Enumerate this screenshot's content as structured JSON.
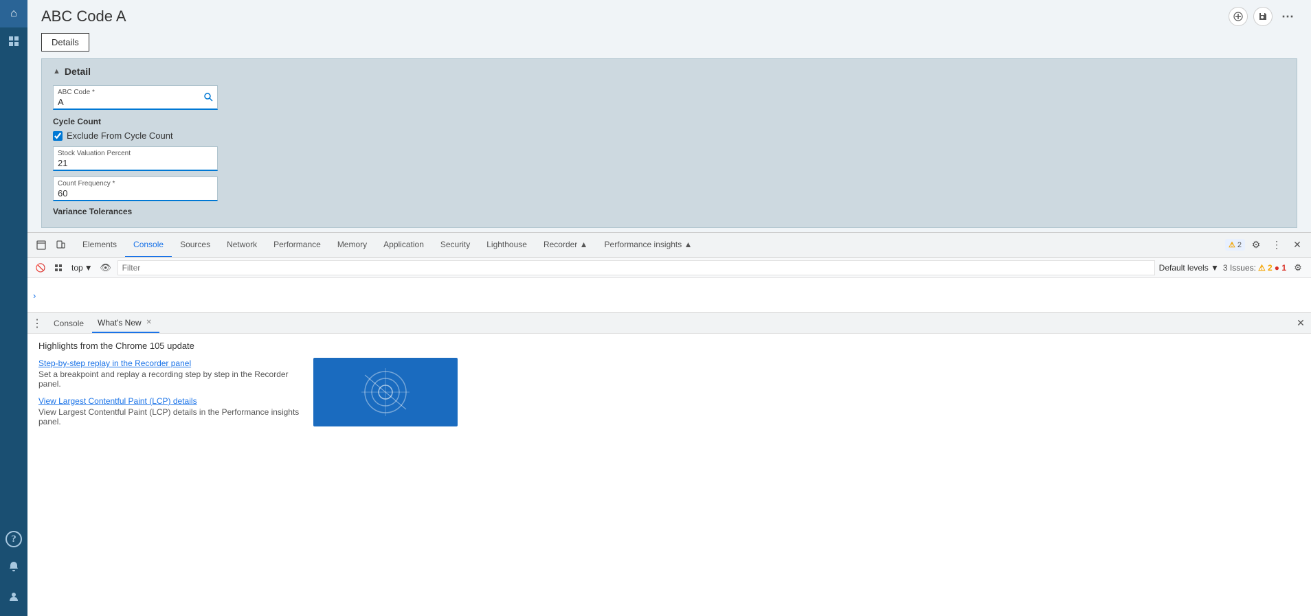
{
  "sidebar": {
    "icons": [
      {
        "name": "home-icon",
        "symbol": "⌂",
        "active": true
      },
      {
        "name": "grid-icon",
        "symbol": "⊞",
        "active": false
      },
      {
        "name": "help-icon",
        "symbol": "?",
        "active": false
      },
      {
        "name": "bell-icon",
        "symbol": "🔔",
        "active": false
      },
      {
        "name": "user-icon",
        "symbol": "👤",
        "active": false
      }
    ]
  },
  "page": {
    "title": "ABC Code A",
    "tabs": [
      {
        "label": "Details",
        "active": true
      }
    ]
  },
  "title_actions": {
    "add_label": "+",
    "save_label": "💾",
    "more_label": "⋯"
  },
  "detail_section": {
    "header": "Detail",
    "fields": {
      "abc_code": {
        "label": "ABC Code *",
        "value": "A"
      },
      "cycle_count_label": "Cycle Count",
      "exclude_from_cycle_count": {
        "label": "Exclude From Cycle Count",
        "checked": true
      },
      "stock_valuation_percent": {
        "label": "Stock Valuation Percent",
        "value": "21"
      },
      "count_frequency": {
        "label": "Count Frequency *",
        "value": "60"
      },
      "variance_tolerances": "Variance Tolerances"
    }
  },
  "devtools": {
    "tabs": [
      {
        "label": "Elements",
        "active": false
      },
      {
        "label": "Console",
        "active": true
      },
      {
        "label": "Sources",
        "active": false
      },
      {
        "label": "Network",
        "active": false
      },
      {
        "label": "Performance",
        "active": false
      },
      {
        "label": "Memory",
        "active": false
      },
      {
        "label": "Application",
        "active": false
      },
      {
        "label": "Security",
        "active": false
      },
      {
        "label": "Lighthouse",
        "active": false
      },
      {
        "label": "Recorder ▲",
        "active": false
      },
      {
        "label": "Performance insights ▲",
        "active": false
      }
    ],
    "issues_badge": "2",
    "issues_count": "3 Issues:",
    "issues_warn": "2",
    "issues_err": "1",
    "top_context": "top",
    "filter_placeholder": "Filter",
    "default_levels": "Default levels ▼"
  },
  "bottom_panel": {
    "tabs": [
      {
        "label": "Console",
        "closeable": false
      },
      {
        "label": "What's New",
        "closeable": true,
        "active": true
      }
    ],
    "whats_new_title": "Highlights from the Chrome 105 update",
    "links": [
      {
        "title": "Step-by-step replay in the Recorder panel",
        "description": "Set a breakpoint and replay a recording step by step in the Recorder panel."
      },
      {
        "title": "View Largest Contentful Paint (LCP) details",
        "description": "View Largest Contentful Paint (LCP) details in the Performance insights panel."
      }
    ]
  }
}
